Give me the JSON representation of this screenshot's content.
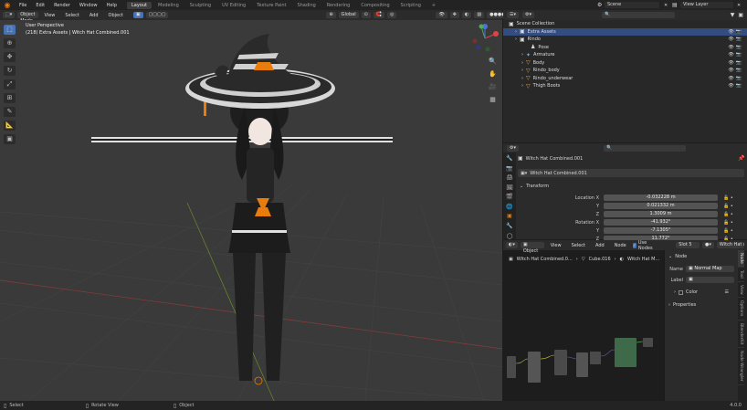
{
  "menubar": {
    "menus": [
      "File",
      "Edit",
      "Render",
      "Window",
      "Help"
    ],
    "workspaces": [
      "Layout",
      "Modeling",
      "Sculpting",
      "UV Editing",
      "Texture Paint",
      "Shading",
      "Rendering",
      "Compositing",
      "Scripting"
    ],
    "active_workspace": "Layout",
    "scene": "Scene",
    "view_layer": "View Layer"
  },
  "viewport": {
    "mode": "Object Mode",
    "menus": [
      "View",
      "Select",
      "Add",
      "Object"
    ],
    "transform_orientation": "Global",
    "overlay_title": "User Perspective",
    "overlay_subtitle": "(218) Extra Assets | Witch Hat Combined.001"
  },
  "outliner": {
    "title": "Scene Collection",
    "rows": [
      {
        "label": "Extra Assets",
        "indent": 1,
        "icon": "collection-icon",
        "selected": true
      },
      {
        "label": "Rindo",
        "indent": 1,
        "icon": "collection-icon",
        "selected": false
      },
      {
        "label": "Pose",
        "indent": 3,
        "icon": "pose-icon",
        "selected": false
      },
      {
        "label": "Armature",
        "indent": 2,
        "icon": "armature-icon",
        "selected": false
      },
      {
        "label": "Body",
        "indent": 2,
        "icon": "mesh-icon",
        "selected": false
      },
      {
        "label": "Rindo_body",
        "indent": 2,
        "icon": "mesh-icon",
        "selected": false
      },
      {
        "label": "Rindo_underwear",
        "indent": 2,
        "icon": "mesh-icon",
        "selected": false
      },
      {
        "label": "Thigh Boots",
        "indent": 2,
        "icon": "mesh-icon",
        "selected": false
      }
    ]
  },
  "properties": {
    "object_name": "Witch Hat Combined.001",
    "data_name": "Witch Hat Combined.001",
    "panel": "Transform",
    "fields": [
      {
        "label": "Location X",
        "value": "-0.032228 m"
      },
      {
        "label": "Y",
        "value": "0.021332 m"
      },
      {
        "label": "Z",
        "value": "1.3009 m"
      },
      {
        "label": "Rotation X",
        "value": "-41.932°"
      },
      {
        "label": "Y",
        "value": "-7.1305°"
      },
      {
        "label": "Z",
        "value": "11.772°"
      }
    ]
  },
  "node_editor": {
    "object_btn": "Object",
    "menus": [
      "View",
      "Select",
      "Add",
      "Node"
    ],
    "use_nodes": "Use Nodes",
    "slot": "Slot 5",
    "material": "Witch Hat Main",
    "breadcrumb": [
      "Witch Hat Combined.0...",
      "Cube.016",
      "Witch Hat M..."
    ],
    "side_title": "Node",
    "name_label": "Name",
    "name_value": "Normal Map",
    "label_label": "Label",
    "color_label": "Color",
    "properties_label": "Properties",
    "tabs": [
      "Node",
      "Tool",
      "View",
      "Options",
      "BlenderKit",
      "Node Wrangler"
    ]
  },
  "statusbar": {
    "select": "Select",
    "rotate": "Rotate View",
    "object": "Object",
    "version": "4.0.0"
  },
  "colors": {
    "accent": "#4772b3",
    "selected_row": "#334d80",
    "blender_orange": "#e87d0d"
  }
}
